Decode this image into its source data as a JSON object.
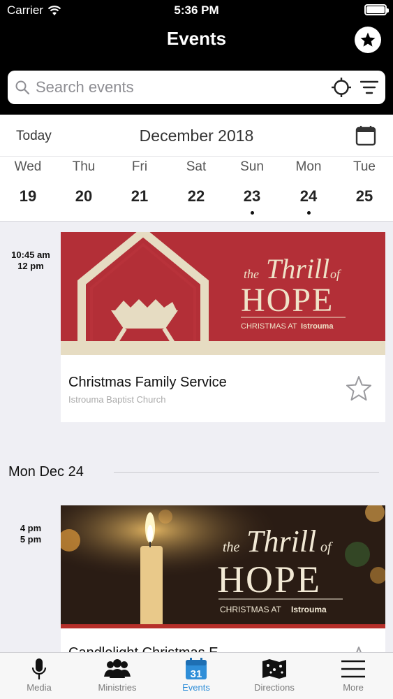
{
  "status_bar": {
    "carrier": "Carrier",
    "time": "5:36 PM"
  },
  "nav": {
    "title": "Events"
  },
  "search": {
    "placeholder": "Search events"
  },
  "date_header": {
    "today_label": "Today",
    "month_label": "December 2018",
    "days": [
      {
        "name": "Wed",
        "num": "19",
        "has_events": false
      },
      {
        "name": "Thu",
        "num": "20",
        "has_events": false
      },
      {
        "name": "Fri",
        "num": "21",
        "has_events": false
      },
      {
        "name": "Sat",
        "num": "22",
        "has_events": false
      },
      {
        "name": "Sun",
        "num": "23",
        "has_events": true
      },
      {
        "name": "Mon",
        "num": "24",
        "has_events": true
      },
      {
        "name": "Tue",
        "num": "25",
        "has_events": false
      }
    ]
  },
  "events": [
    {
      "start": "10:45 am",
      "end": "12 pm",
      "title": "Christmas Family Service",
      "location": "Istrouma Baptist Church",
      "banner": {
        "line1": "the",
        "line2": "Thrill",
        "line3": "of",
        "line4": "HOPE",
        "tag": "CHRISTMAS AT",
        "brand": "Istrouma"
      }
    },
    {
      "start": "4 pm",
      "end": "5 pm",
      "title": "Candlelight Christmas E",
      "location": "",
      "banner": {
        "line1": "the",
        "line2": "Thrill",
        "line3": "of",
        "line4": "HOPE",
        "tag": "CHRISTMAS AT",
        "brand": "Istrouma"
      }
    }
  ],
  "sections": [
    {
      "label": "Mon Dec 24"
    }
  ],
  "tabs": [
    {
      "label": "Media",
      "icon": "microphone-icon"
    },
    {
      "label": "Ministries",
      "icon": "people-icon"
    },
    {
      "label": "Events",
      "icon": "calendar-31-icon",
      "active": true
    },
    {
      "label": "Directions",
      "icon": "map-icon"
    },
    {
      "label": "More",
      "icon": "hamburger-icon"
    }
  ],
  "colors": {
    "active_tab": "#2f8ed8",
    "header_bg": "#000000",
    "banner1_bg": "#b8323a",
    "banner2_bg": "#2a1c14"
  }
}
